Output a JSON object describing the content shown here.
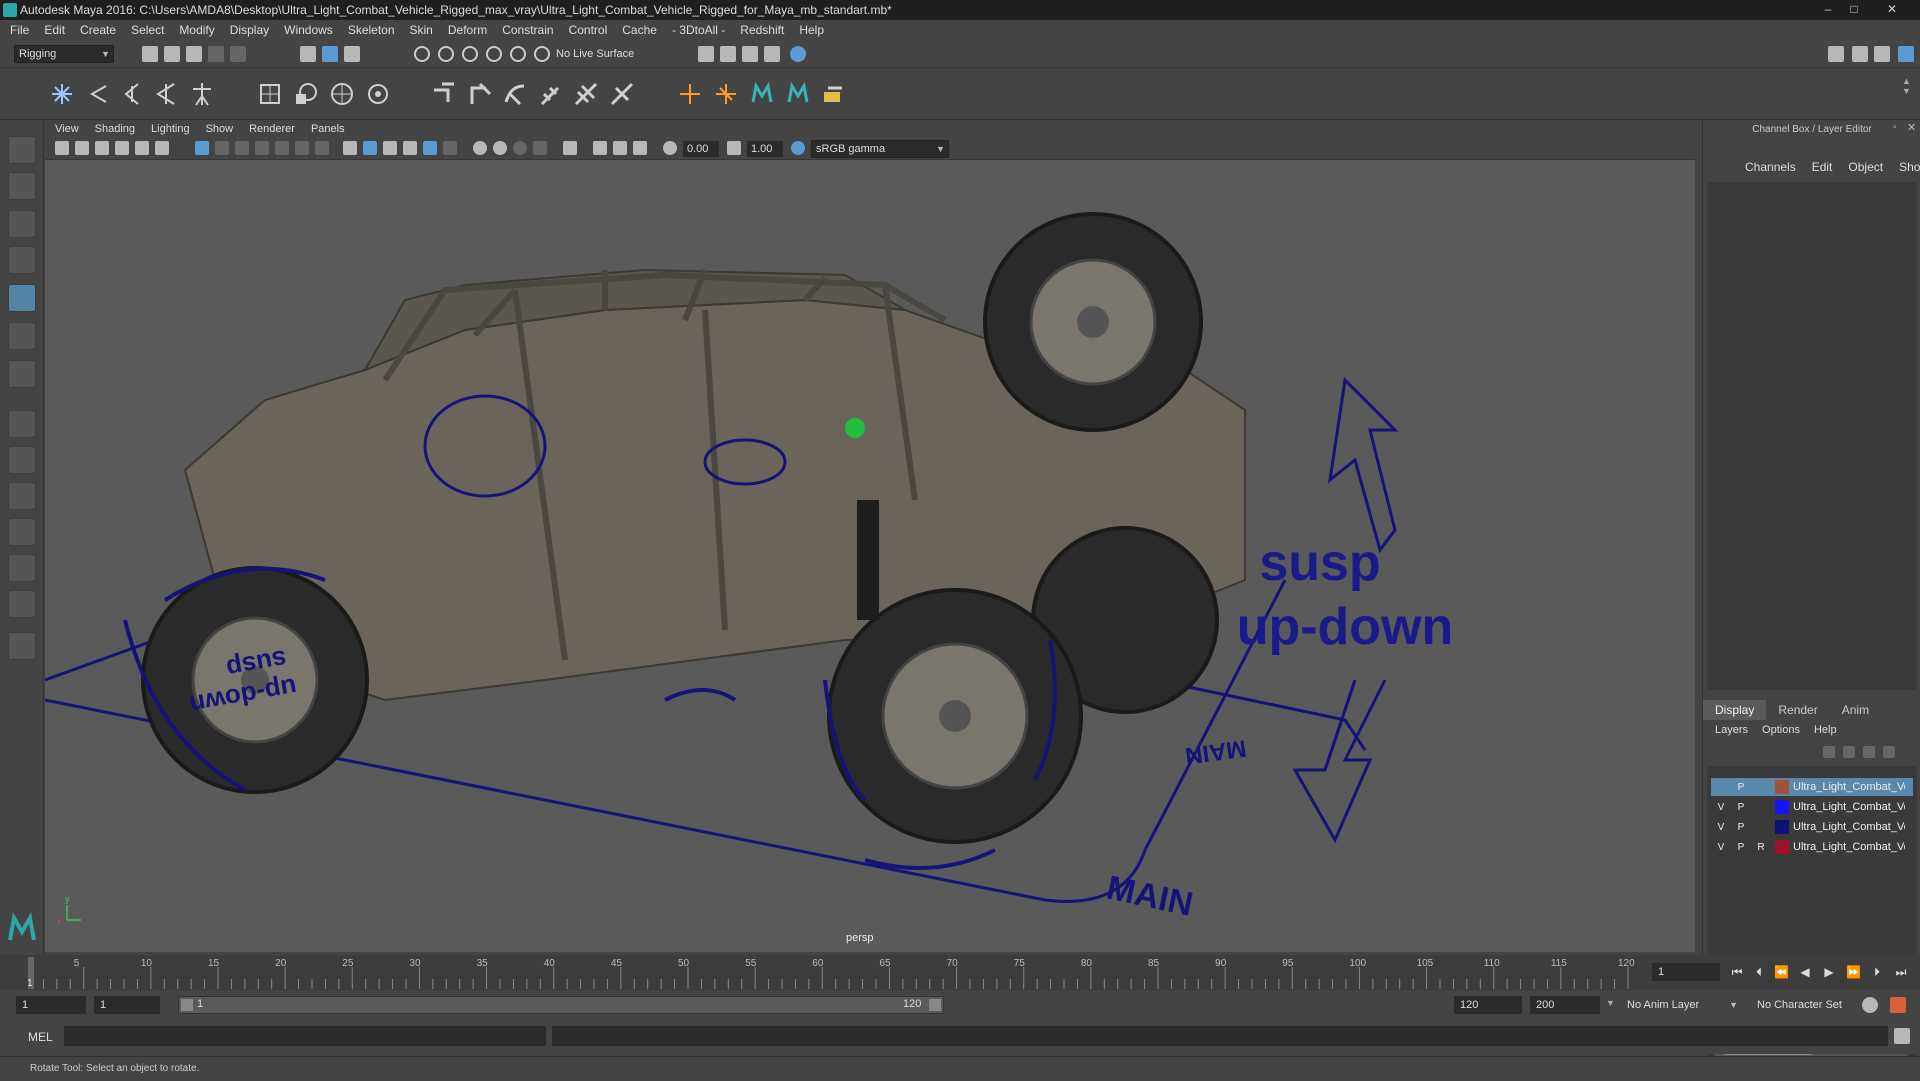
{
  "titlebar": {
    "title": "Autodesk Maya 2016: C:\\Users\\AMDA8\\Desktop\\Ultra_Light_Combat_Vehicle_Rigged_max_vray\\Ultra_Light_Combat_Vehicle_Rigged_for_Maya_mb_standart.mb*",
    "minimize": "–",
    "maximize": "□",
    "close": "✕"
  },
  "menubar": [
    "File",
    "Edit",
    "Create",
    "Select",
    "Modify",
    "Display",
    "Windows",
    "Skeleton",
    "Skin",
    "Deform",
    "Constrain",
    "Control",
    "Cache",
    "- 3DtoAll -",
    "Redshift",
    "Help"
  ],
  "shelf": {
    "mode": "Rigging",
    "live_surface": "No Live Surface"
  },
  "viewport": {
    "menu": [
      "View",
      "Shading",
      "Lighting",
      "Show",
      "Renderer",
      "Panels"
    ],
    "exposure": "0.00",
    "gamma": "1.00",
    "color_space": "sRGB gamma",
    "camera": "persp",
    "labels": {
      "susp_line1": "susp",
      "susp_line2": "up-down",
      "main": "MAIN",
      "main_rear": "MAIN",
      "wheel_label1": "susp",
      "wheel_label2": "up-down"
    },
    "axis": {
      "y": "y",
      "x": "x"
    }
  },
  "channel_box": {
    "title": "Channel Box / Layer Editor",
    "tabs": [
      "Channels",
      "Edit",
      "Object",
      "Show"
    ]
  },
  "layer_editor": {
    "tabs": [
      "Display",
      "Render",
      "Anim"
    ],
    "active_tab": "Display",
    "menu": [
      "Layers",
      "Options",
      "Help"
    ],
    "layers": [
      {
        "v": "",
        "p": "P",
        "r": "",
        "color": "#a0523c",
        "name": "Ultra_Light_Combat_Vehicle",
        "selected": true
      },
      {
        "v": "V",
        "p": "P",
        "r": "",
        "color": "#1414ff",
        "name": "Ultra_Light_Combat_Vehicle",
        "selected": false
      },
      {
        "v": "V",
        "p": "P",
        "r": "",
        "color": "#10107a",
        "name": "Ultra_Light_Combat_Vehicle",
        "selected": false
      },
      {
        "v": "V",
        "p": "P",
        "r": "R",
        "color": "#a0102a",
        "name": "Ultra_Light_Combat_Vehicle",
        "selected": false
      }
    ]
  },
  "timeline": {
    "ticks": [
      "5",
      "10",
      "15",
      "20",
      "25",
      "30",
      "35",
      "40",
      "45",
      "50",
      "55",
      "60",
      "65",
      "70",
      "75",
      "80",
      "85",
      "90",
      "95",
      "100",
      "105",
      "110",
      "115",
      "120"
    ],
    "current_frame_marker": "1",
    "current_frame": "1",
    "playback_icons": [
      "skip-start-icon",
      "step-back-key-icon",
      "step-back-icon",
      "play-back-icon",
      "play-icon",
      "step-forward-icon",
      "step-forward-key-icon",
      "skip-end-icon"
    ]
  },
  "range": {
    "start": "1",
    "playback_start": "1",
    "slider_start": "1",
    "slider_end": "120",
    "playback_end": "120",
    "end": "200",
    "anim_layer": "No Anim Layer",
    "character_set": "No Character Set"
  },
  "command": {
    "label": "MEL"
  },
  "help_line": "Rotate Tool: Select an object to rotate."
}
